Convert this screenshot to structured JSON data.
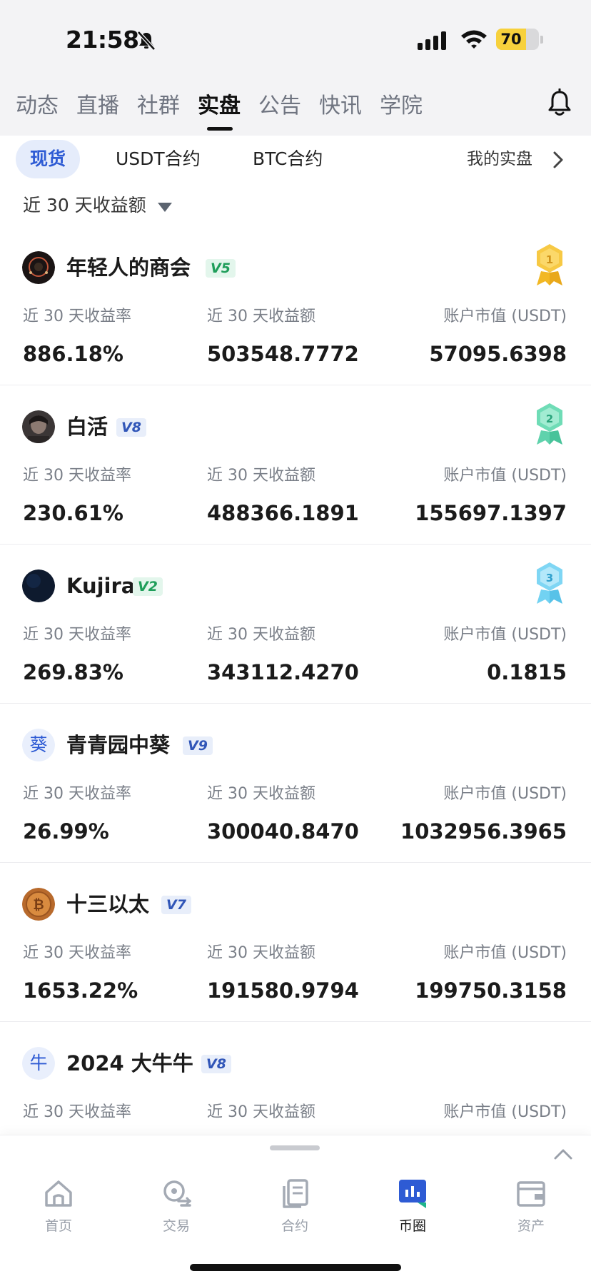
{
  "status_bar": {
    "time": "21:58",
    "battery": "70",
    "battery_level_percent": 70
  },
  "top_tabs": [
    {
      "label": "动态",
      "active": false
    },
    {
      "label": "直播",
      "active": false
    },
    {
      "label": "社群",
      "active": false
    },
    {
      "label": "实盘",
      "active": true
    },
    {
      "label": "公告",
      "active": false
    },
    {
      "label": "快讯",
      "active": false
    },
    {
      "label": "学院",
      "active": false
    }
  ],
  "sub_tabs": [
    {
      "label": "现货",
      "active": true
    },
    {
      "label": "USDT合约",
      "active": false
    },
    {
      "label": "BTC合约",
      "active": false
    }
  ],
  "my_real_label": "我的实盘",
  "sort_label": "近 30 天收益额",
  "stat_labels": {
    "rate": "近 30 天收益率",
    "amount": "近 30 天收益额",
    "account": "账户市值 (USDT)"
  },
  "traders": [
    {
      "name": "年轻人的商会",
      "vip": "V5",
      "rate": "886.18%",
      "amount": "503548.7772",
      "account": "57095.6398",
      "medal": "1",
      "avatar_text": ""
    },
    {
      "name": "白活",
      "vip": "V8",
      "rate": "230.61%",
      "amount": "488366.1891",
      "account": "155697.1397",
      "medal": "2",
      "avatar_text": ""
    },
    {
      "name": "Kujira",
      "vip": "V2",
      "rate": "269.83%",
      "amount": "343112.4270",
      "account": "0.1815",
      "medal": "3",
      "avatar_text": ""
    },
    {
      "name": "青青园中葵",
      "vip": "V9",
      "rate": "26.99%",
      "amount": "300040.8470",
      "account": "1032956.3965",
      "medal": "",
      "avatar_text": "葵"
    },
    {
      "name": "十三以太",
      "vip": "V7",
      "rate": "1653.22%",
      "amount": "191580.9794",
      "account": "199750.3158",
      "medal": "",
      "avatar_text": ""
    },
    {
      "name": "2024 大牛牛",
      "vip": "V8",
      "rate": "",
      "amount": "",
      "account": "",
      "medal": "",
      "avatar_text": "牛"
    }
  ],
  "bottom_nav": [
    {
      "label": "首页",
      "icon": "home-icon",
      "active": false
    },
    {
      "label": "交易",
      "icon": "trade-icon",
      "active": false
    },
    {
      "label": "合约",
      "icon": "contract-icon",
      "active": false
    },
    {
      "label": "币圈",
      "icon": "community-icon",
      "active": true
    },
    {
      "label": "资产",
      "icon": "wallet-icon",
      "active": false
    }
  ],
  "colors": {
    "accent": "#2e5bd4",
    "vip_green": "#1f9e5a",
    "vip_blue": "#3156b8",
    "gold": "#f2b824",
    "teal": "#3cc8a0",
    "cyan": "#4cc3ea"
  }
}
